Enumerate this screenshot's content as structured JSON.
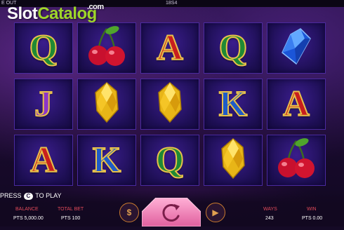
{
  "topbar": {
    "exit_label": "E OUT",
    "session_id": "18S4"
  },
  "logo": {
    "part1": "Slot",
    "part2": "Catalog",
    "domain": ".com"
  },
  "reels": [
    [
      "Q",
      "cherry",
      "A",
      "Q",
      "blue-gem"
    ],
    [
      "J",
      "yellow-gem",
      "yellow-gem",
      "K",
      "A"
    ],
    [
      "A",
      "K",
      "Q",
      "yellow-gem",
      "cherry"
    ]
  ],
  "symbol_colors": {
    "A": "#c81e1e",
    "Q": "#1f8a34",
    "J": "#8d35c8",
    "K": "#1f5cc8"
  },
  "press_to_play": {
    "before": "PRESS",
    "key": "C",
    "after": "TO PLAY"
  },
  "stats": {
    "balance_label": "BALANCE",
    "balance_value": "PTS 5,000.00",
    "total_bet_label": "TOTAL BET",
    "total_bet_value": "PTS 100",
    "ways_label": "WAYS",
    "ways_value": "243",
    "win_label": "WIN",
    "win_value": "PTS 0.00"
  },
  "controls": {
    "coin_icon": "coin-icon",
    "spin_icon": "spin-icon",
    "autoplay_icon": "autoplay-icon"
  },
  "colors": {
    "accent": "#e24a5a",
    "spin_pink": "#f27ab0",
    "logo_green": "#9fd62a"
  }
}
